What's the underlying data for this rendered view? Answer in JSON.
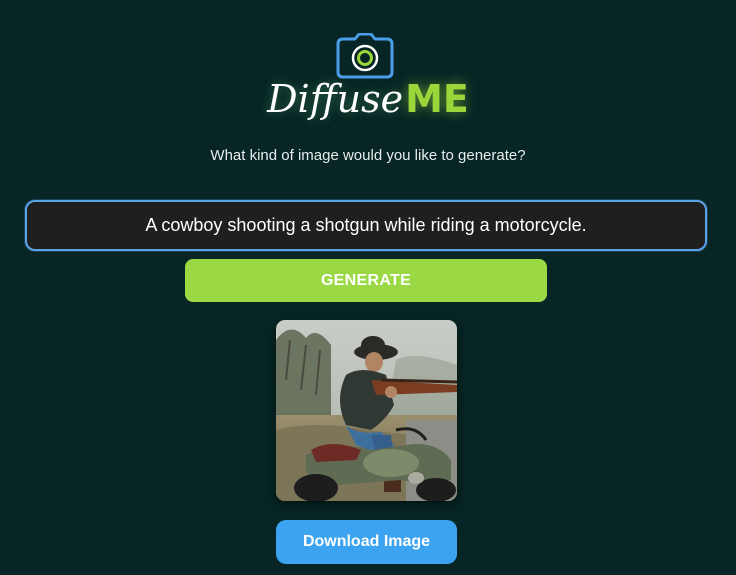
{
  "logo": {
    "icon": "camera-icon",
    "text_part1": "Diffuse",
    "text_part2": "ME",
    "colors": {
      "camera_outline": "#4a9ee8",
      "lens": "#9ad63a",
      "me_text": "#9ad63a"
    }
  },
  "prompt": {
    "label": "What kind of image would you like to generate?",
    "value": "A cowboy shooting a shotgun while riding a motorcycle."
  },
  "actions": {
    "generate_label": "GENERATE",
    "download_label": "Download Image"
  },
  "result": {
    "image_alt": "generated-image"
  },
  "colors": {
    "background": "#062524",
    "generate_button": "#9bd944",
    "download_button": "#3ba3f0",
    "input_border": "#5aa3e6"
  }
}
